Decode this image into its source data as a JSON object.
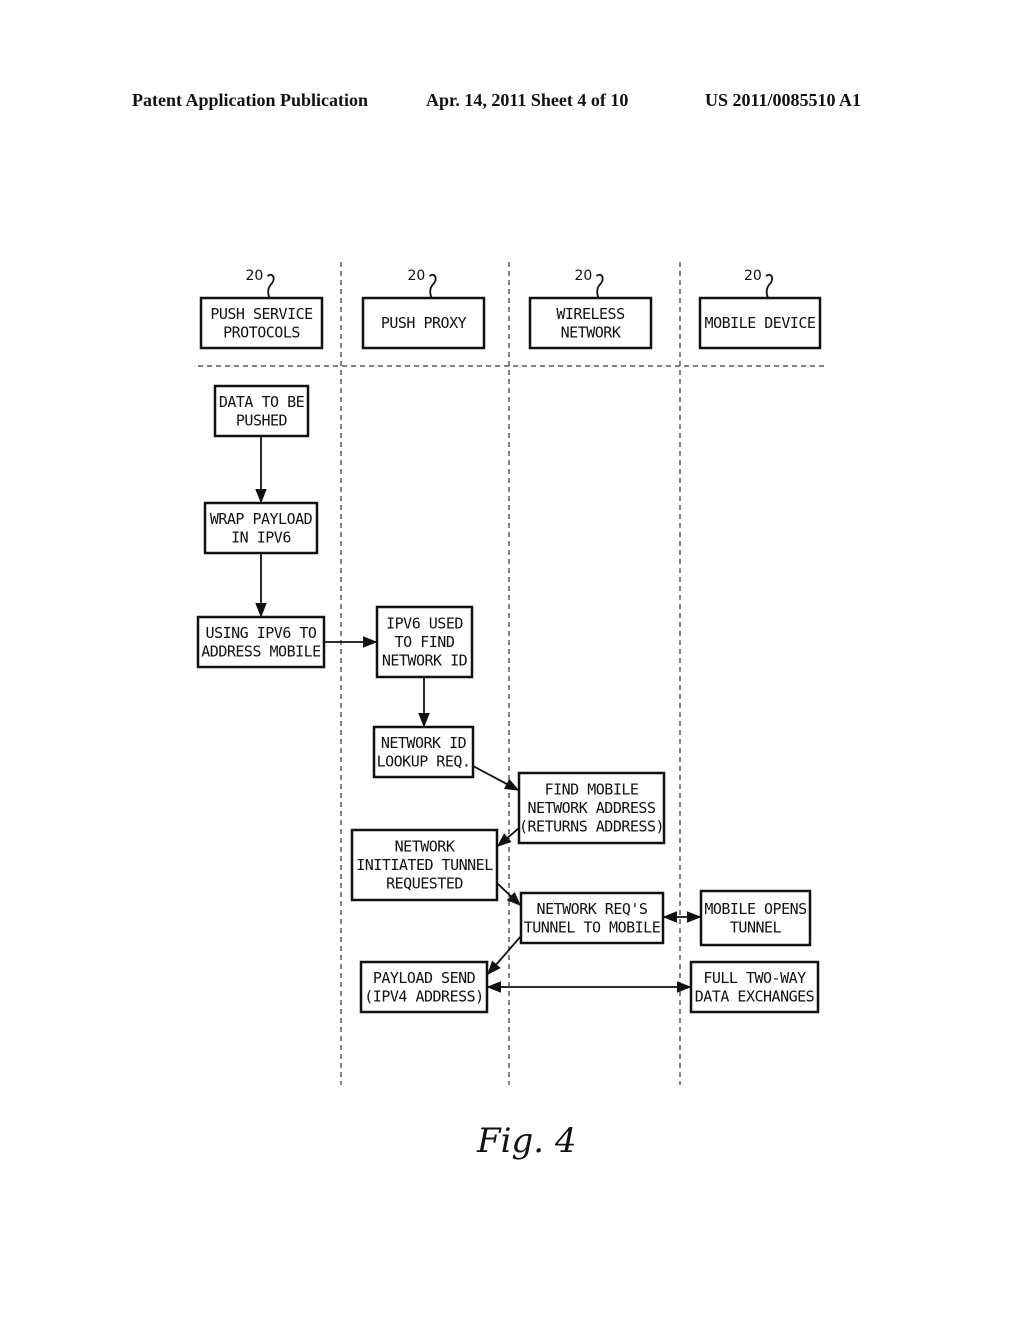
{
  "header": {
    "left": "Patent Application Publication",
    "middle": "Apr. 14, 2011  Sheet 4 of 10",
    "right": "US 2011/0085510 A1"
  },
  "figure_label": "Fig. 4",
  "lanes": [
    {
      "id": "lane-push-service",
      "ref": "20",
      "lines": [
        "PUSH SERVICE",
        "PROTOCOLS"
      ]
    },
    {
      "id": "lane-push-proxy",
      "ref": "20",
      "lines": [
        "PUSH PROXY"
      ]
    },
    {
      "id": "lane-wireless-network",
      "ref": "20",
      "lines": [
        "WIRELESS",
        "NETWORK"
      ]
    },
    {
      "id": "lane-mobile-device",
      "ref": "20",
      "lines": [
        "MOBILE DEVICE"
      ]
    }
  ],
  "nodes": [
    {
      "id": "data-to-be-pushed",
      "lane": 0,
      "lines": [
        "DATA TO BE",
        "PUSHED"
      ]
    },
    {
      "id": "wrap-payload",
      "lane": 0,
      "lines": [
        "WRAP PAYLOAD",
        "IN IPV6"
      ]
    },
    {
      "id": "using-ipv6",
      "lane": 0,
      "lines": [
        "USING IPV6 TO",
        "ADDRESS MOBILE"
      ]
    },
    {
      "id": "ipv6-used",
      "lane": 1,
      "lines": [
        "IPV6 USED",
        "TO FIND",
        "NETWORK ID"
      ]
    },
    {
      "id": "network-id-lookup",
      "lane": 1,
      "lines": [
        "NETWORK ID",
        "LOOKUP REQ."
      ]
    },
    {
      "id": "find-mobile",
      "lane": 2,
      "lines": [
        "FIND MOBILE",
        "NETWORK ADDRESS",
        "(RETURNS ADDRESS)"
      ]
    },
    {
      "id": "network-initiated-tunnel",
      "lane": 1,
      "lines": [
        "NETWORK",
        "INITIATED TUNNEL",
        "REQUESTED"
      ]
    },
    {
      "id": "network-reqs-tunnel",
      "lane": 2,
      "lines": [
        "NETWORK REQ'S",
        "TUNNEL TO MOBILE"
      ]
    },
    {
      "id": "mobile-opens-tunnel",
      "lane": 3,
      "lines": [
        "MOBILE OPENS",
        "TUNNEL"
      ]
    },
    {
      "id": "payload-send",
      "lane": 1,
      "lines": [
        "PAYLOAD SEND",
        "(IPV4 ADDRESS)"
      ]
    },
    {
      "id": "full-two-way",
      "lane": 3,
      "lines": [
        "FULL TWO-WAY",
        "DATA EXCHANGES"
      ]
    }
  ],
  "edges": [
    {
      "from": "data-to-be-pushed",
      "to": "wrap-payload",
      "type": "arrow"
    },
    {
      "from": "wrap-payload",
      "to": "using-ipv6",
      "type": "arrow"
    },
    {
      "from": "using-ipv6",
      "to": "ipv6-used",
      "type": "arrow"
    },
    {
      "from": "ipv6-used",
      "to": "network-id-lookup",
      "type": "arrow"
    },
    {
      "from": "network-id-lookup",
      "to": "find-mobile",
      "type": "arrow"
    },
    {
      "from": "find-mobile",
      "to": "network-initiated-tunnel",
      "type": "arrow"
    },
    {
      "from": "network-initiated-tunnel",
      "to": "network-reqs-tunnel",
      "type": "arrow"
    },
    {
      "from": "network-reqs-tunnel",
      "to": "mobile-opens-tunnel",
      "type": "bidirectional"
    },
    {
      "from": "network-reqs-tunnel",
      "to": "payload-send",
      "type": "arrow"
    },
    {
      "from": "payload-send",
      "to": "full-two-way",
      "type": "bidirectional"
    }
  ]
}
